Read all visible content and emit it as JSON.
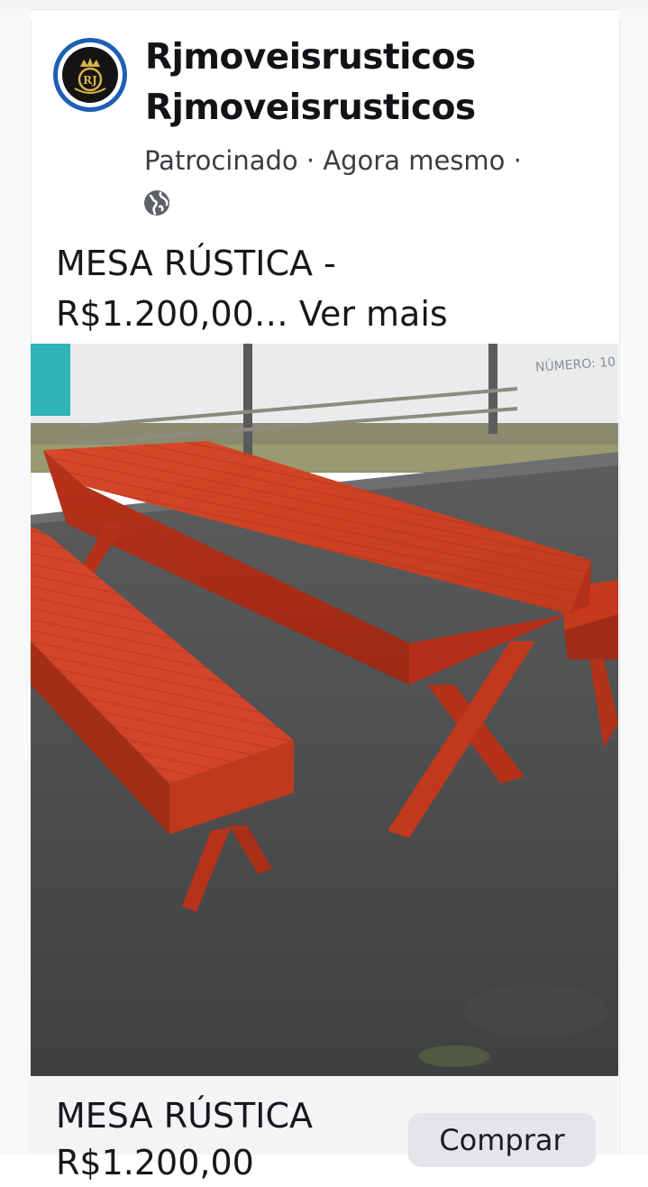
{
  "post": {
    "page_name_line1": "Rjmoveisrusticos",
    "page_name_line2": "Rjmoveisrusticos",
    "meta": "Patrocinado · Agora mesmo ·",
    "avatar_text": "RJ",
    "caption_line1": "MESA RÚSTICA -",
    "caption_line2_price": "R$1.200,00…",
    "caption_more": "Ver mais",
    "photo_wall_text": "NÚMERO: 10"
  },
  "cta": {
    "title": "MESA RÚSTICA",
    "price": "R$1.200,00",
    "button_label": "Comprar"
  },
  "icons": {
    "privacy": "globe-icon",
    "avatar": "crown-crest-icon"
  },
  "colors": {
    "avatar_ring": "#1d5fb5",
    "wood": "#c93a1c",
    "button_bg": "#e3e5e9"
  }
}
